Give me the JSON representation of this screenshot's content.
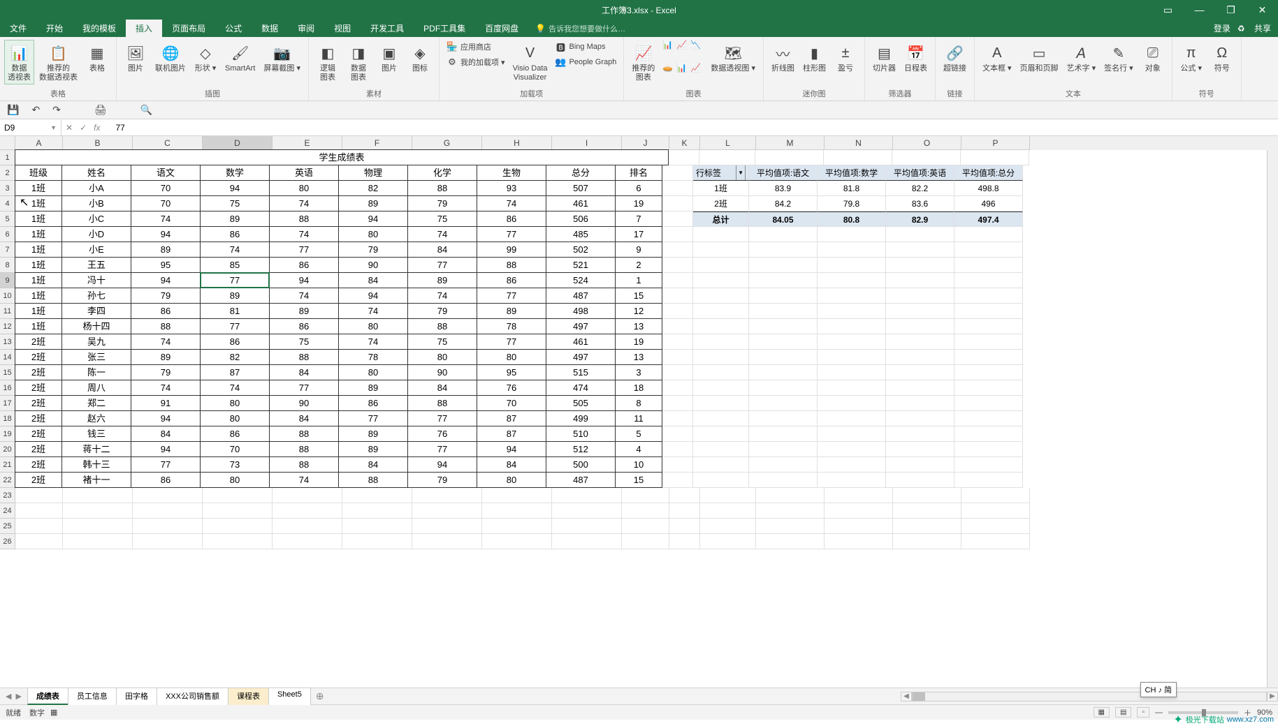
{
  "titlebar": {
    "title": "工作簿3.xlsx - Excel"
  },
  "menubar": {
    "tabs": [
      "文件",
      "开始",
      "我的模板",
      "插入",
      "页面布局",
      "公式",
      "数据",
      "审阅",
      "视图",
      "开发工具",
      "PDF工具集",
      "百度网盘"
    ],
    "active_index": 3,
    "tell_me": "告诉我您想要做什么…",
    "login": "登录",
    "share": "共享"
  },
  "ribbon": {
    "groups": [
      {
        "label": "表格",
        "items": [
          {
            "icon": "📊",
            "text": "数据\n透视表",
            "name": "pivot-table-button",
            "highlight": true
          },
          {
            "icon": "📋",
            "text": "推荐的\n数据透视表",
            "name": "recommended-pivot-button"
          },
          {
            "icon": "▦",
            "text": "表格",
            "name": "table-button"
          }
        ]
      },
      {
        "label": "插图",
        "items": [
          {
            "icon": "🖼",
            "text": "图片",
            "name": "picture-button"
          },
          {
            "icon": "🌐",
            "text": "联机图片",
            "name": "online-picture-button"
          },
          {
            "icon": "◇",
            "text": "形状",
            "name": "shapes-button",
            "dd": true
          },
          {
            "icon": "🖌",
            "text": "SmartArt",
            "name": "smartart-button"
          },
          {
            "icon": "📷",
            "text": "屏幕截图",
            "name": "screenshot-button",
            "dd": true
          }
        ]
      },
      {
        "label": "素材",
        "items": [
          {
            "icon": "◧",
            "text": "逻辑\n图表",
            "name": "logic-chart-button"
          },
          {
            "icon": "◨",
            "text": "数据\n图表",
            "name": "data-chart-button"
          },
          {
            "icon": "▣",
            "text": "图片",
            "name": "sucai-picture-button"
          },
          {
            "icon": "◈",
            "text": "图标",
            "name": "icon-button"
          }
        ]
      },
      {
        "label": "加载项",
        "stack": [
          {
            "icon": "🏪",
            "text": "应用商店",
            "name": "store-button"
          },
          {
            "icon": "⚙",
            "text": "我的加载项",
            "name": "my-addins-button",
            "dd": true
          }
        ],
        "col2": {
          "icon": "V",
          "text": "Visio Data\nVisualizer",
          "name": "visio-button"
        },
        "col3": [
          {
            "icon": "🅱",
            "text": "Bing Maps",
            "name": "bing-maps-button"
          },
          {
            "icon": "👥",
            "text": "People Graph",
            "name": "people-graph-button"
          }
        ]
      },
      {
        "label": "图表",
        "items": [
          {
            "icon": "📈",
            "text": "推荐的\n图表",
            "name": "recommended-chart-button"
          }
        ],
        "mini": true,
        "extra": {
          "icon": "🗺",
          "text": "数据透视图",
          "name": "pivot-chart-button",
          "dd": true
        }
      },
      {
        "label": "迷你图",
        "items": [
          {
            "icon": "〰",
            "text": "折线图",
            "name": "sparkline-line-button"
          },
          {
            "icon": "▮",
            "text": "柱形图",
            "name": "sparkline-column-button"
          },
          {
            "icon": "±",
            "text": "盈亏",
            "name": "sparkline-winloss-button"
          }
        ]
      },
      {
        "label": "筛选器",
        "items": [
          {
            "icon": "▤",
            "text": "切片器",
            "name": "slicer-button"
          },
          {
            "icon": "📅",
            "text": "日程表",
            "name": "timeline-button"
          }
        ]
      },
      {
        "label": "链接",
        "items": [
          {
            "icon": "🔗",
            "text": "超链接",
            "name": "hyperlink-button"
          }
        ]
      },
      {
        "label": "文本",
        "items": [
          {
            "icon": "A",
            "text": "文本框",
            "name": "textbox-button",
            "dd": true
          },
          {
            "icon": "▭",
            "text": "页眉和页脚",
            "name": "header-footer-button"
          },
          {
            "icon": "𝘈",
            "text": "艺术字",
            "name": "wordart-button",
            "dd": true
          },
          {
            "icon": "✎",
            "text": "签名行",
            "name": "signature-button",
            "dd": true
          },
          {
            "icon": "⎚",
            "text": "对象",
            "name": "object-button"
          }
        ]
      },
      {
        "label": "符号",
        "items": [
          {
            "icon": "π",
            "text": "公式",
            "name": "equation-button",
            "dd": true
          },
          {
            "icon": "Ω",
            "text": "符号",
            "name": "symbol-button"
          }
        ]
      }
    ]
  },
  "qat": [
    "💾",
    "↶",
    "↷",
    "",
    "🖨",
    "",
    "🔍"
  ],
  "formula_bar": {
    "namebox": "D9",
    "value": "77"
  },
  "columns": [
    "A",
    "B",
    "C",
    "D",
    "E",
    "F",
    "G",
    "H",
    "I",
    "J",
    "K",
    "L",
    "M",
    "N",
    "O",
    "P"
  ],
  "active_col": "D",
  "active_row": 9,
  "table": {
    "title": "学生成绩表",
    "headers": [
      "班级",
      "姓名",
      "语文",
      "数学",
      "英语",
      "物理",
      "化学",
      "生物",
      "总分",
      "排名"
    ],
    "rows": [
      [
        "1班",
        "小A",
        "70",
        "94",
        "80",
        "82",
        "88",
        "93",
        "507",
        "6"
      ],
      [
        "1班",
        "小B",
        "70",
        "75",
        "74",
        "89",
        "79",
        "74",
        "461",
        "19"
      ],
      [
        "1班",
        "小C",
        "74",
        "89",
        "88",
        "94",
        "75",
        "86",
        "506",
        "7"
      ],
      [
        "1班",
        "小D",
        "94",
        "86",
        "74",
        "80",
        "74",
        "77",
        "485",
        "17"
      ],
      [
        "1班",
        "小E",
        "89",
        "74",
        "77",
        "79",
        "84",
        "99",
        "502",
        "9"
      ],
      [
        "1班",
        "王五",
        "95",
        "85",
        "86",
        "90",
        "77",
        "88",
        "521",
        "2"
      ],
      [
        "1班",
        "冯十",
        "94",
        "77",
        "94",
        "84",
        "89",
        "86",
        "524",
        "1"
      ],
      [
        "1班",
        "孙七",
        "79",
        "89",
        "74",
        "94",
        "74",
        "77",
        "487",
        "15"
      ],
      [
        "1班",
        "李四",
        "86",
        "81",
        "89",
        "74",
        "79",
        "89",
        "498",
        "12"
      ],
      [
        "1班",
        "杨十四",
        "88",
        "77",
        "86",
        "80",
        "88",
        "78",
        "497",
        "13"
      ],
      [
        "2班",
        "吴九",
        "74",
        "86",
        "75",
        "74",
        "75",
        "77",
        "461",
        "19"
      ],
      [
        "2班",
        "张三",
        "89",
        "82",
        "88",
        "78",
        "80",
        "80",
        "497",
        "13"
      ],
      [
        "2班",
        "陈一",
        "79",
        "87",
        "84",
        "80",
        "90",
        "95",
        "515",
        "3"
      ],
      [
        "2班",
        "周八",
        "74",
        "74",
        "77",
        "89",
        "84",
        "76",
        "474",
        "18"
      ],
      [
        "2班",
        "郑二",
        "91",
        "80",
        "90",
        "86",
        "88",
        "70",
        "505",
        "8"
      ],
      [
        "2班",
        "赵六",
        "94",
        "80",
        "84",
        "77",
        "77",
        "87",
        "499",
        "11"
      ],
      [
        "2班",
        "钱三",
        "84",
        "86",
        "88",
        "89",
        "76",
        "87",
        "510",
        "5"
      ],
      [
        "2班",
        "蒋十二",
        "94",
        "70",
        "88",
        "89",
        "77",
        "94",
        "512",
        "4"
      ],
      [
        "2班",
        "韩十三",
        "77",
        "73",
        "88",
        "84",
        "94",
        "84",
        "500",
        "10"
      ],
      [
        "2班",
        "褚十一",
        "86",
        "80",
        "74",
        "88",
        "79",
        "80",
        "487",
        "15"
      ]
    ]
  },
  "pivot": {
    "headers": [
      "行标签",
      "平均值项:语文",
      "平均值项:数学",
      "平均值项:英语",
      "平均值项:总分"
    ],
    "rows": [
      [
        "1班",
        "83.9",
        "81.8",
        "82.2",
        "498.8"
      ],
      [
        "2班",
        "84.2",
        "79.8",
        "83.6",
        "496"
      ]
    ],
    "total": [
      "总计",
      "84.05",
      "80.8",
      "82.9",
      "497.4"
    ]
  },
  "sheets": {
    "tabs": [
      "成绩表",
      "员工信息",
      "田字格",
      "XXX公司销售额",
      "课程表",
      "Sheet5"
    ],
    "active_index": 0,
    "hover_index": 4
  },
  "statusbar": {
    "ready": "就绪",
    "num": "数字",
    "zoom": "90%"
  },
  "ime": "CH ♪ 简",
  "watermark": {
    "brand": "极光下载站",
    "url": "www.xz7.com"
  }
}
